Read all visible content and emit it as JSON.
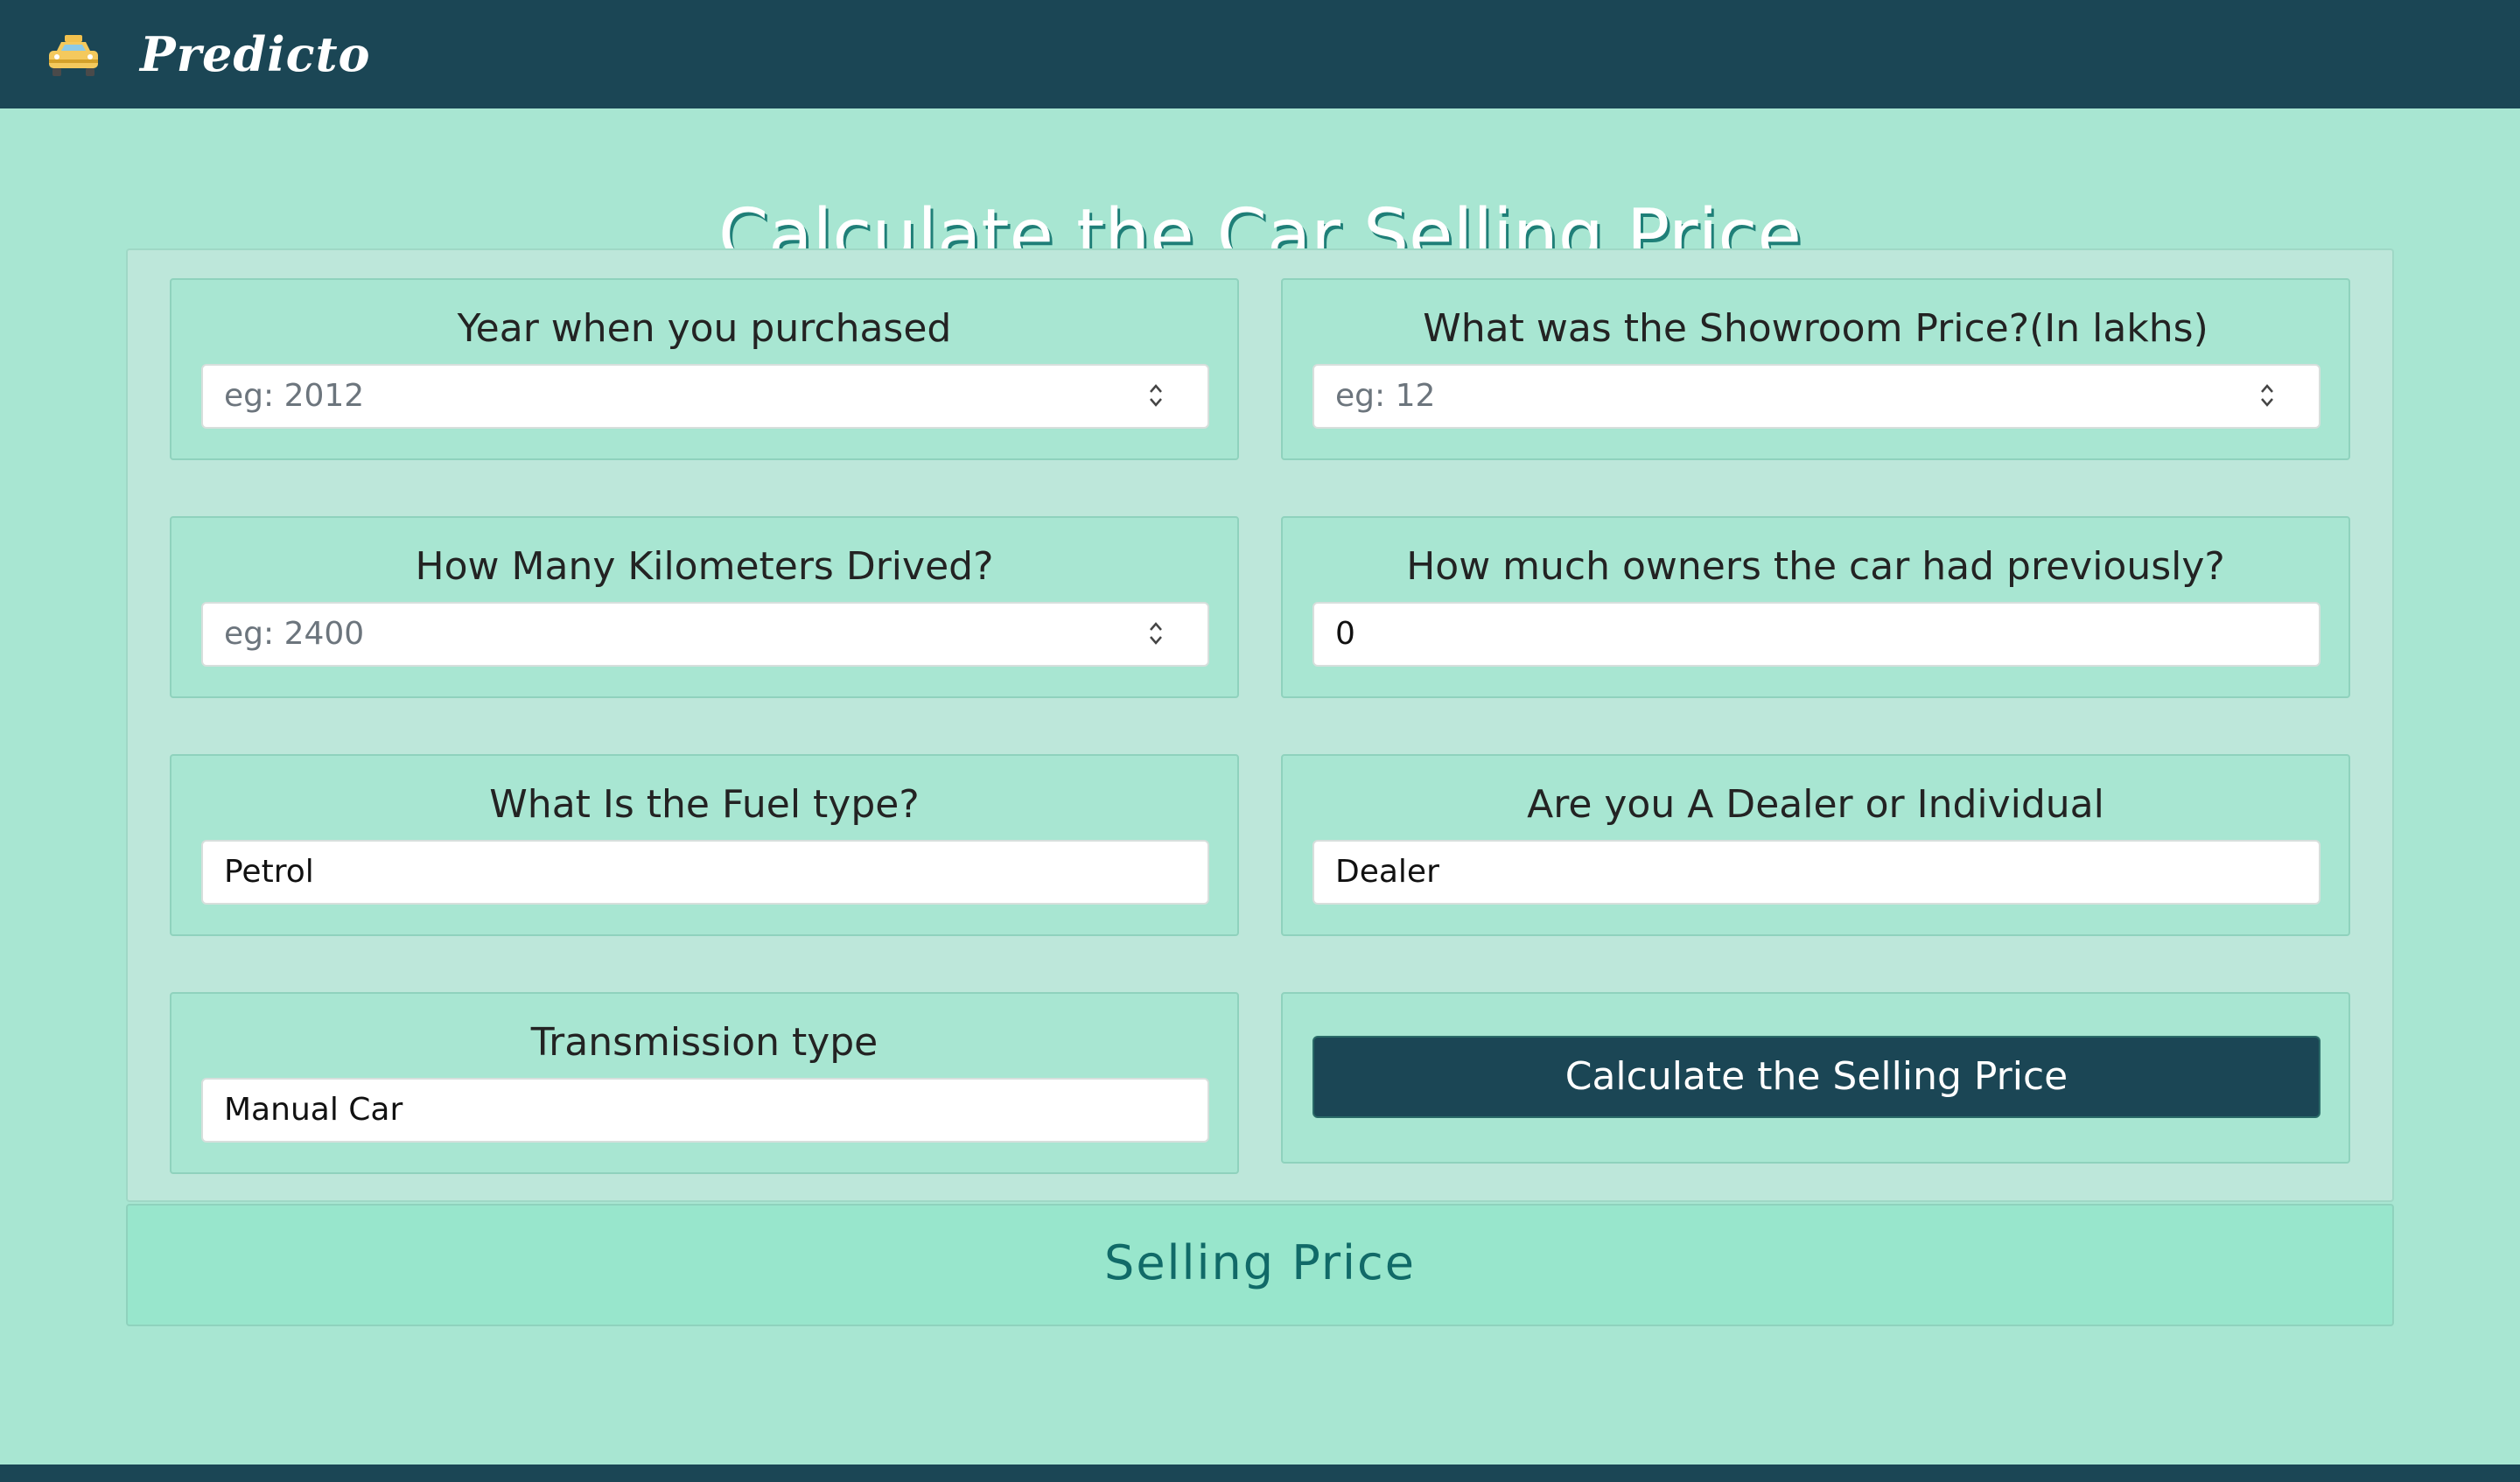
{
  "navbar": {
    "brand_name": "Predicto",
    "brand_icon": "car-icon"
  },
  "page_title": "Calculate the Car Selling Price",
  "form": {
    "year": {
      "label": "Year when you purchased",
      "placeholder": "eg: 2012",
      "value": ""
    },
    "showroom_price": {
      "label": "What was the Showroom Price?(In lakhs)",
      "placeholder": "eg: 12",
      "value": ""
    },
    "kilometers": {
      "label": "How Many Kilometers Drived?",
      "placeholder": "eg: 2400",
      "value": ""
    },
    "owners": {
      "label": "How much owners the car had previously?",
      "value": "0"
    },
    "fuel_type": {
      "label": "What Is the Fuel type?",
      "selected": "Petrol"
    },
    "seller_type": {
      "label": "Are you A Dealer or Individual",
      "selected": "Dealer"
    },
    "transmission": {
      "label": "Transmission type",
      "selected": "Manual Car"
    },
    "submit_label": "Calculate the Selling Price"
  },
  "result": {
    "label": "Selling Price"
  },
  "colors": {
    "navbar": "#1b4655",
    "background": "#a8e6d2",
    "panel": "#bde7da",
    "result": "#98e6cc",
    "accent_text": "#116a68"
  }
}
